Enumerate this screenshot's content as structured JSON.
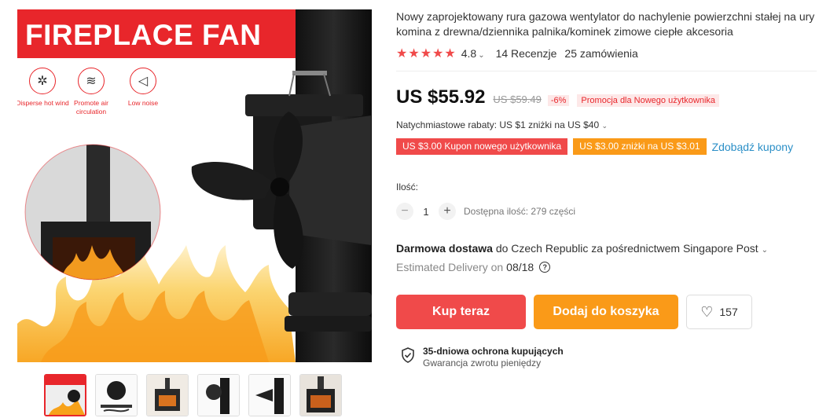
{
  "gallery": {
    "banner_text": "FIREPLACE FAN",
    "features": [
      {
        "icon": "wind-swirl-icon",
        "label": "Disperse hot wind"
      },
      {
        "icon": "airflow-icon",
        "label": "Promote air circulation"
      },
      {
        "icon": "speaker-icon",
        "label": "Low noise"
      }
    ],
    "thumbnails": [
      {
        "name": "thumb-1-fireplace-fan",
        "active": true
      },
      {
        "name": "thumb-2-fan-parts"
      },
      {
        "name": "thumb-3-stove"
      },
      {
        "name": "thumb-4-fan-on-pipe"
      },
      {
        "name": "thumb-5-fan-side"
      },
      {
        "name": "thumb-6-fireplace"
      }
    ]
  },
  "product": {
    "title": "Nowy zaprojektowany rura gazowa wentylator do nachylenie powierzchni stałej na ury komina z drewna/dziennika palnika/kominek zimowe ciepłe akcesoria",
    "stars": "★★★★★",
    "rating": "4.8",
    "reviews": "14 Recenzje",
    "orders": "25 zamówienia",
    "price": "US $55.92",
    "old_price": "US $59.49",
    "discount": "-6%",
    "promo": "Promocja dla Nowego użytkownika",
    "rebates": "Natychmiastowe rabaty: US $1 zniżki na US $40",
    "coupons": [
      {
        "label": "US $3.00 Kupon nowego użytkownika",
        "color": "#f04a4a"
      },
      {
        "label": "US $3.00 zniżki na US $3.01",
        "color": "#fa9a18"
      }
    ],
    "get_coupons": "Zdobądź kupony",
    "quantity_label": "Ilość:",
    "quantity": "1",
    "stock": "Dostępna ilość: 279 części",
    "shipping_bold": "Darmowa dostawa",
    "shipping_rest": "do Czech Republic za pośrednictwem Singapore Post",
    "delivery_label": "Estimated Delivery on",
    "delivery_date": "08/18",
    "buy_label": "Kup teraz",
    "cart_label": "Dodaj do koszyka",
    "wishlist_count": "157",
    "protection_title": "35-dniowa ochrona kupujących",
    "protection_sub": "Gwarancja zwrotu pieniędzy"
  },
  "colors": {
    "accent_red": "#f04a4a",
    "accent_orange": "#fa9a18",
    "link_blue": "#2b8fc7",
    "banner_red": "#e8262b"
  }
}
